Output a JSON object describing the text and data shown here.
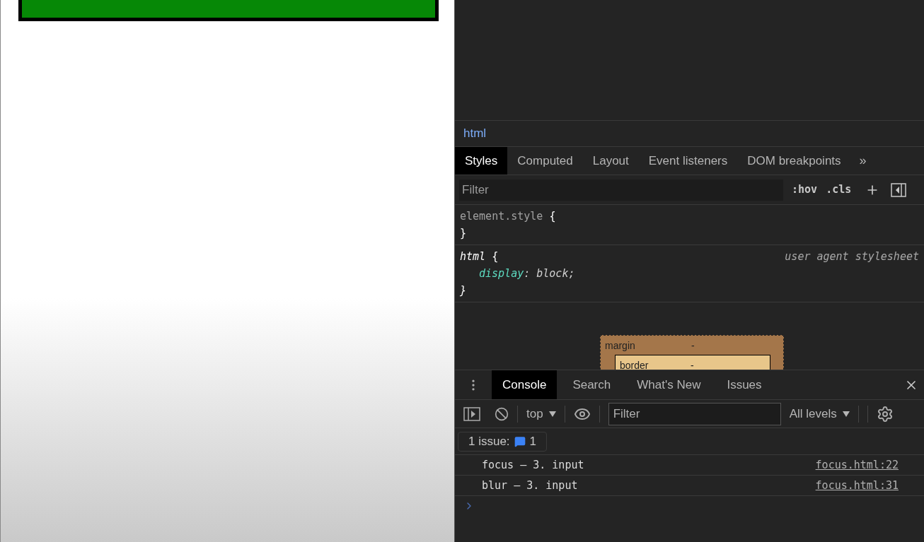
{
  "breadcrumb": "html",
  "style_tabs": [
    {
      "label": "Styles",
      "selected": true
    },
    {
      "label": "Computed",
      "selected": false
    },
    {
      "label": "Layout",
      "selected": false
    },
    {
      "label": "Event listeners",
      "selected": false
    },
    {
      "label": "DOM breakpoints",
      "selected": false
    }
  ],
  "more_tabs": "»",
  "styles_filter": {
    "placeholder": "Filter"
  },
  "style_toggles": [
    ":hov",
    ".cls"
  ],
  "rules": [
    {
      "selector": "element.style",
      "kind": "inline",
      "open": "{",
      "close": "}"
    },
    {
      "selector": "html",
      "kind": "agent",
      "open": "{",
      "close": "}",
      "source": "user agent stylesheet",
      "declarations": [
        {
          "property": "display",
          "separator": ":",
          "value": "block;"
        }
      ]
    }
  ],
  "box_model": {
    "margin_label": "margin",
    "margin_value": "-",
    "border_label": "border",
    "border_value": "-"
  },
  "drawer_tabs": [
    {
      "label": "Console",
      "selected": true
    },
    {
      "label": "Search",
      "selected": false
    },
    {
      "label": "What's New",
      "selected": false
    },
    {
      "label": "Issues",
      "selected": false
    }
  ],
  "console_toolbar": {
    "context": "top",
    "filter": {
      "placeholder": "Filter"
    },
    "levels": "All levels"
  },
  "issues": {
    "label": "1 issue:",
    "count": "1"
  },
  "messages": [
    {
      "text": "focus – 3. input",
      "source": "focus.html:22"
    },
    {
      "text": "blur – 3. input",
      "source": "focus.html:31"
    }
  ]
}
